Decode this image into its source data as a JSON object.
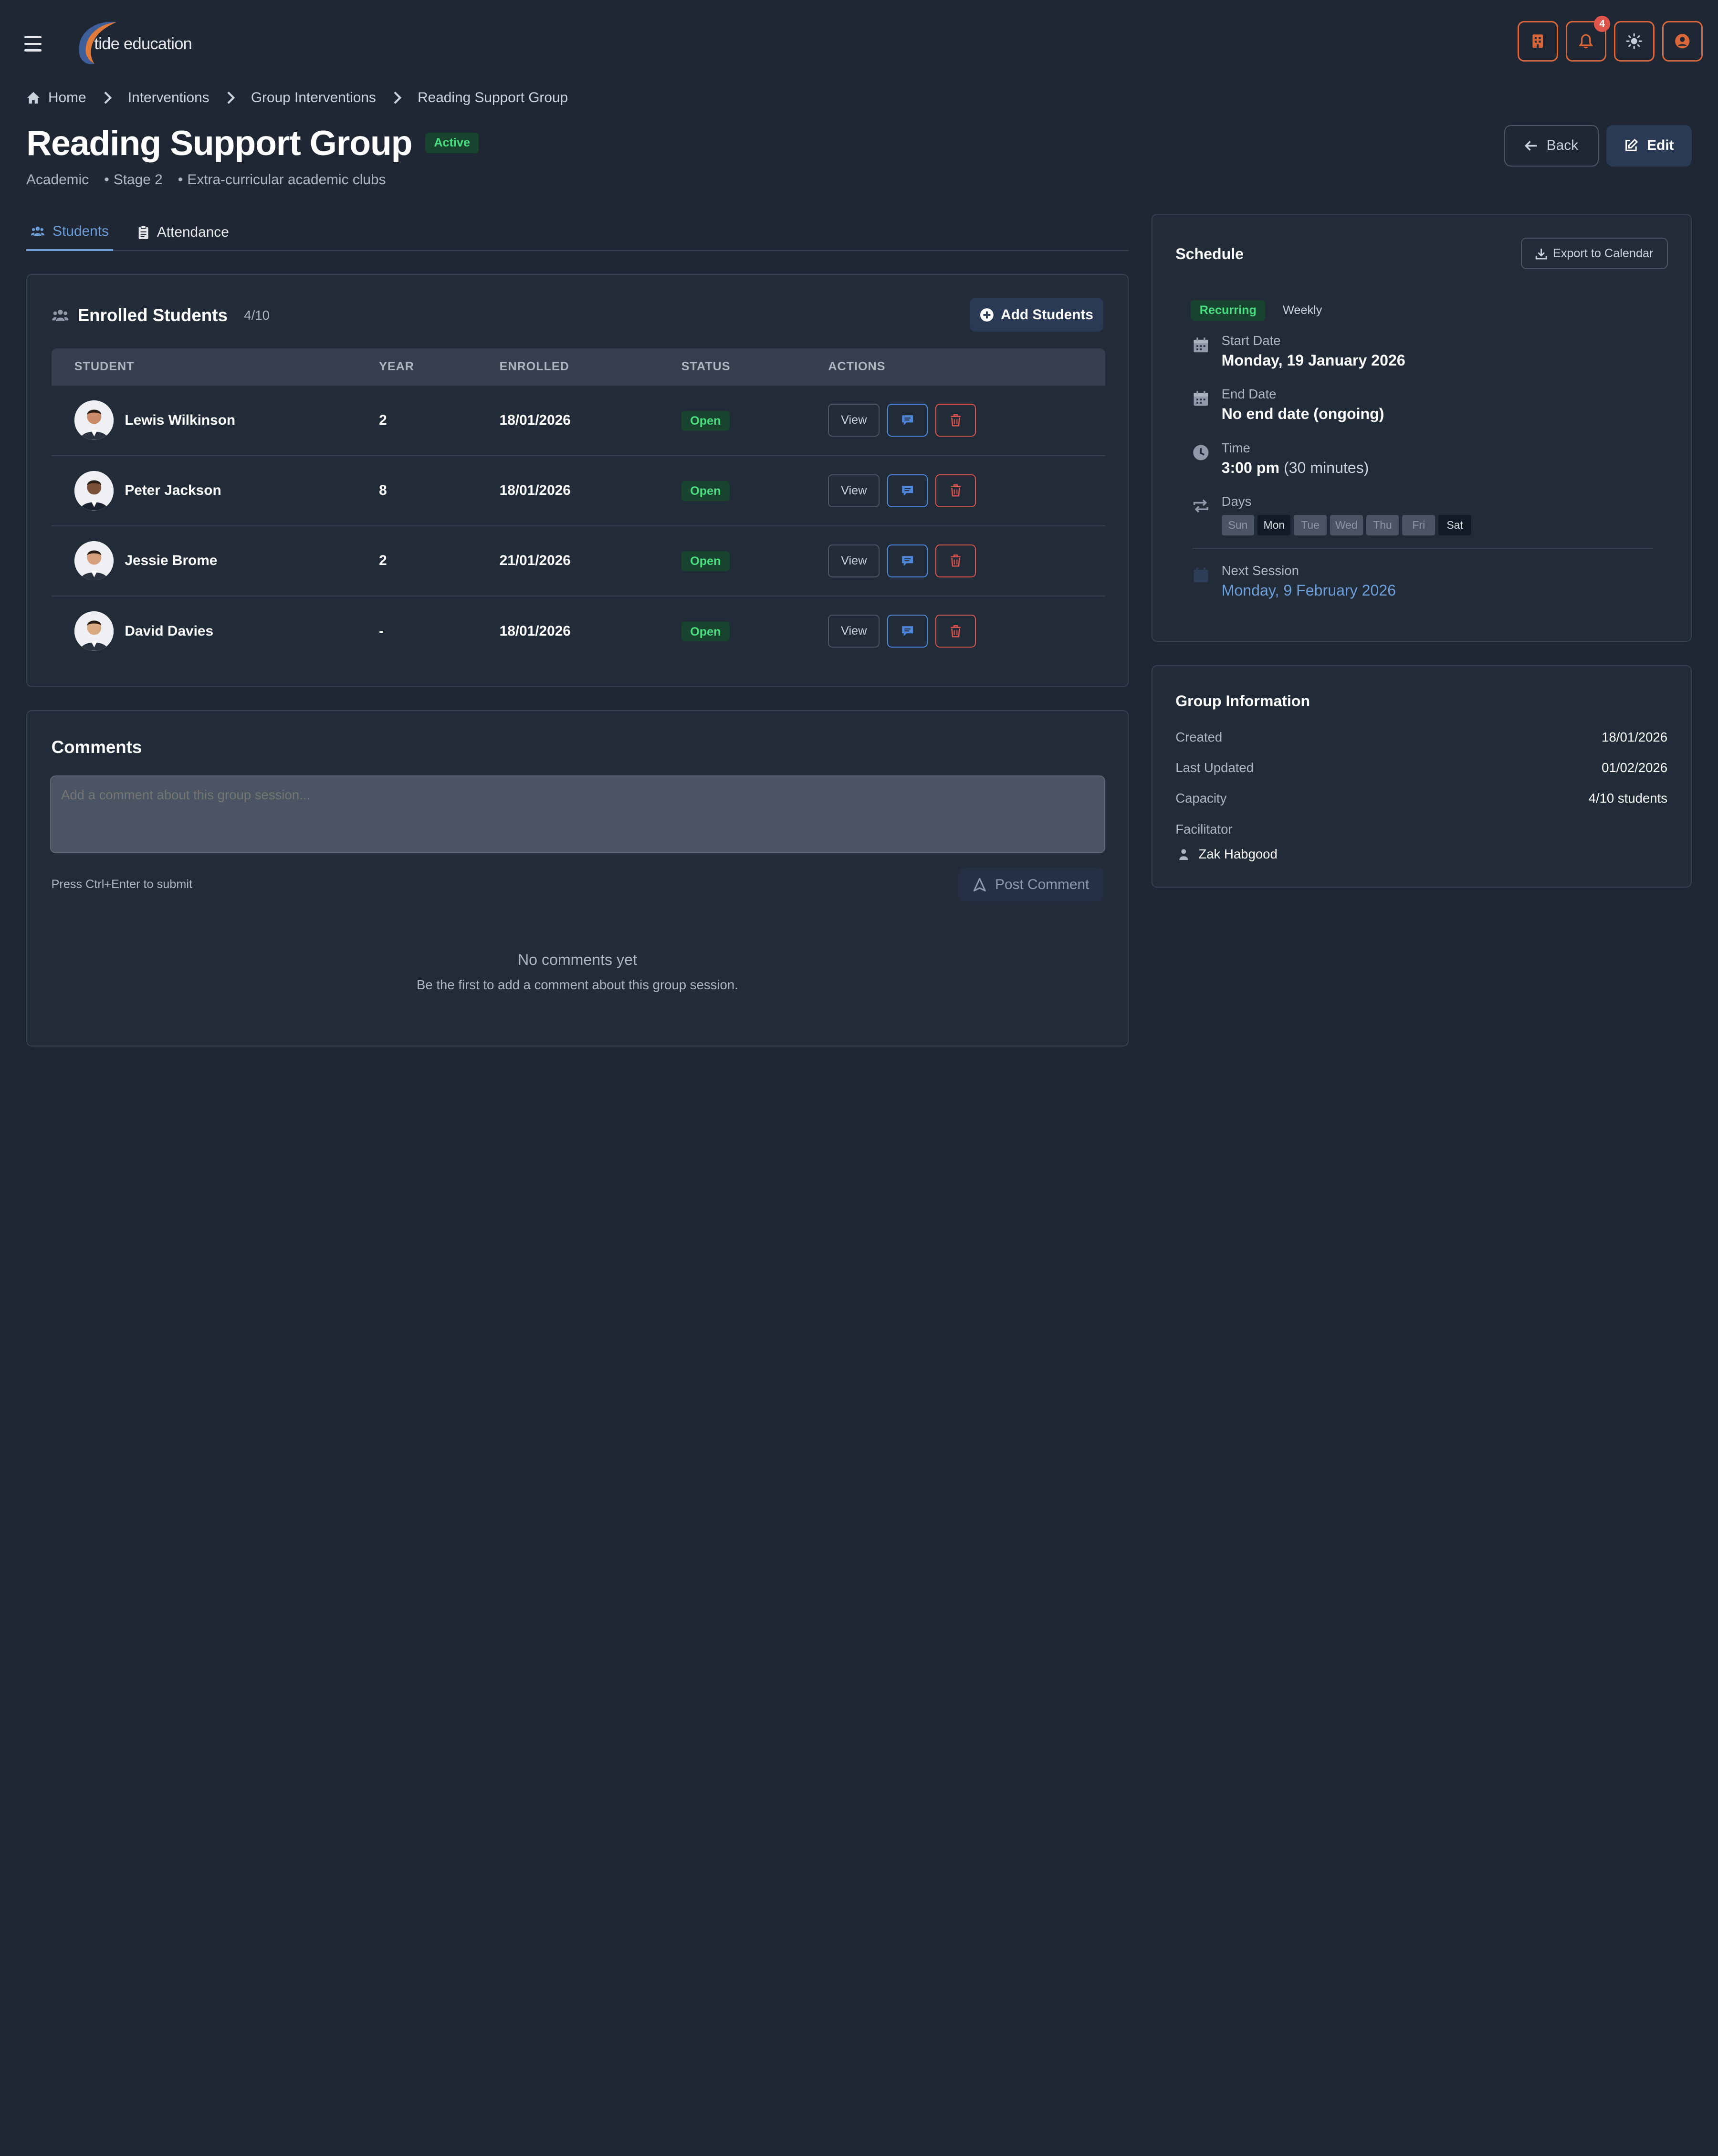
{
  "app": {
    "logo_text": "tide education",
    "notification_count": "4"
  },
  "breadcrumb": [
    "Home",
    "Interventions",
    "Group Interventions",
    "Reading Support Group"
  ],
  "page": {
    "title": "Reading Support Group",
    "status": "Active",
    "meta": [
      "Academic",
      "Stage 2",
      "Extra-curricular academic clubs"
    ],
    "back_label": "Back",
    "edit_label": "Edit"
  },
  "tabs": [
    {
      "label": "Students",
      "active": true
    },
    {
      "label": "Attendance",
      "active": false
    }
  ],
  "enrolled": {
    "title": "Enrolled Students",
    "count": "4/10",
    "add_label": "Add Students",
    "columns": [
      "STUDENT",
      "YEAR",
      "ENROLLED",
      "STATUS",
      "ACTIONS"
    ],
    "view_label": "View",
    "rows": [
      {
        "name": "Lewis Wilkinson",
        "year": "2",
        "enrolled": "18/01/2026",
        "status": "Open"
      },
      {
        "name": "Peter Jackson",
        "year": "8",
        "enrolled": "18/01/2026",
        "status": "Open"
      },
      {
        "name": "Jessie Brome",
        "year": "2",
        "enrolled": "21/01/2026",
        "status": "Open"
      },
      {
        "name": "David Davies",
        "year": "-",
        "enrolled": "18/01/2026",
        "status": "Open"
      }
    ]
  },
  "comments": {
    "title": "Comments",
    "placeholder": "Add a comment about this group session...",
    "hint": "Press Ctrl+Enter to submit",
    "post_label": "Post Comment",
    "empty_title": "No comments yet",
    "empty_text": "Be the first to add a comment about this group session."
  },
  "schedule": {
    "title": "Schedule",
    "export_label": "Export to Calendar",
    "type": "Recurring",
    "frequency": "Weekly",
    "start_label": "Start Date",
    "start_value": "Monday, 19 January 2026",
    "end_label": "End Date",
    "end_value": "No end date (ongoing)",
    "time_label": "Time",
    "time_value": "3:00 pm",
    "time_duration": "(30 minutes)",
    "days_label": "Days",
    "days": [
      {
        "label": "Sun",
        "on": false
      },
      {
        "label": "Mon",
        "on": true
      },
      {
        "label": "Tue",
        "on": false
      },
      {
        "label": "Wed",
        "on": false
      },
      {
        "label": "Thu",
        "on": false
      },
      {
        "label": "Fri",
        "on": false
      },
      {
        "label": "Sat",
        "on": true
      }
    ],
    "next_label": "Next Session",
    "next_value": "Monday, 9 February 2026"
  },
  "group_info": {
    "title": "Group Information",
    "created_label": "Created",
    "created_value": "18/01/2026",
    "updated_label": "Last Updated",
    "updated_value": "01/02/2026",
    "capacity_label": "Capacity",
    "capacity_value": "4/10 students",
    "facilitator_label": "Facilitator",
    "facilitator_value": "Zak Habgood"
  },
  "colors": {
    "accent_orange": "#d9673a",
    "link_blue": "#6e9fd9",
    "success_green": "#4ade80",
    "danger_red": "#d9534f"
  }
}
